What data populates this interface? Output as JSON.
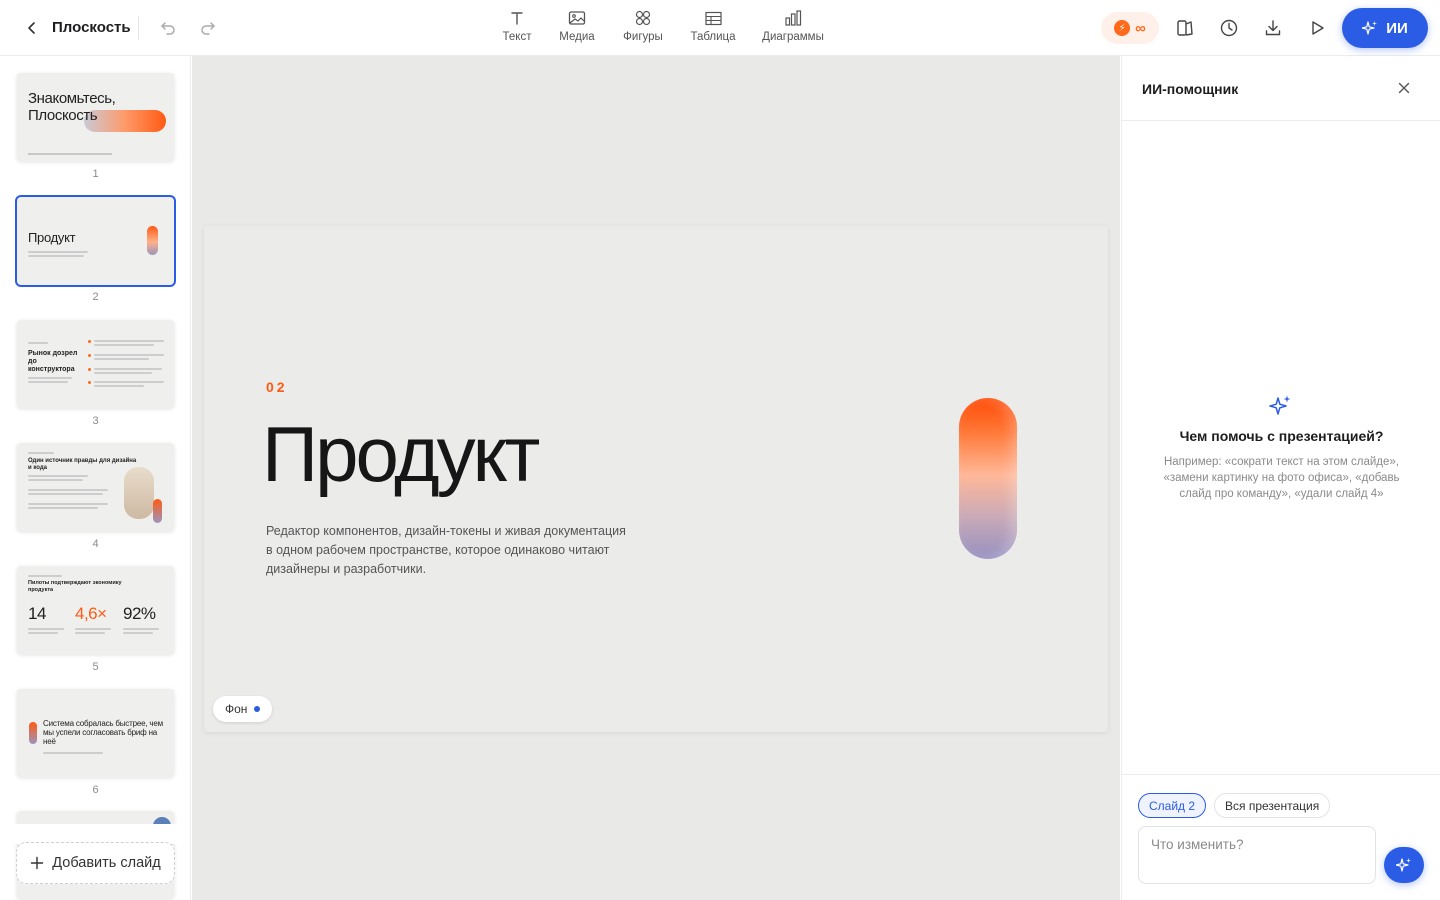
{
  "header": {
    "title": "Плоскость",
    "tools": [
      {
        "label": "Текст",
        "icon": "text-icon"
      },
      {
        "label": "Медиа",
        "icon": "image-icon"
      },
      {
        "label": "Фигуры",
        "icon": "shapes-icon"
      },
      {
        "label": "Таблица",
        "icon": "table-icon"
      },
      {
        "label": "Диаграммы",
        "icon": "chart-icon"
      }
    ],
    "credits": "∞",
    "ai_button": "ИИ"
  },
  "slides": [
    {
      "number": "1",
      "title": "Знакомьтесь, Плоскость"
    },
    {
      "number": "2",
      "title": "Продукт"
    },
    {
      "number": "3",
      "title": "Рынок дозрел до конструктора"
    },
    {
      "number": "4",
      "title": "Один источник правды для дизайна и кода"
    },
    {
      "number": "5",
      "title": "Пилоты подтверждают экономику продукта",
      "stats": [
        "14",
        "4,6×",
        "92%"
      ]
    },
    {
      "number": "6",
      "title": "Система собралась быстрее, чем мы успели согласовать бриф на неё"
    }
  ],
  "add_slide": "Добавить слайд",
  "current_slide": {
    "number": "02",
    "title": "Продукт",
    "description": "Редактор компонентов, дизайн-токены и живая документация в одном рабочем пространстве, которое одинаково читают дизайнеры и разработчики.",
    "background_chip": "Фон"
  },
  "ai_panel": {
    "title": "ИИ-помощник",
    "prompt_title": "Чем помочь с презентацией?",
    "prompt_hint": "Например: «сократи текст на этом слайде», «замени картинку на фото офиса», «добавь слайд про команду», «удали слайд 4»",
    "scope_active": "Слайд 2",
    "scope_inactive": "Вся презентация",
    "input_placeholder": "Что изменить?"
  },
  "colors": {
    "accent": "#2b5ce6",
    "brand_orange": "#ff5a12"
  }
}
